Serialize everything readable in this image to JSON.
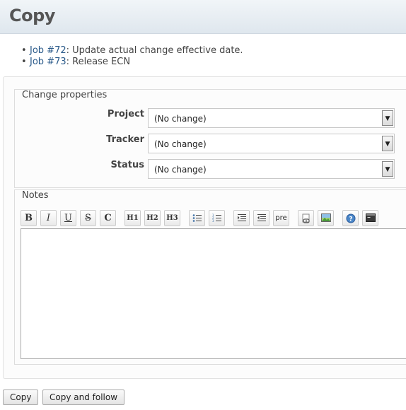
{
  "page": {
    "title": "Copy"
  },
  "jobs": [
    {
      "link": "Job #72",
      "text": ": Update actual change effective date."
    },
    {
      "link": "Job #73",
      "text": ": Release ECN"
    }
  ],
  "properties": {
    "legend": "Change properties",
    "fields": [
      {
        "label": "Project",
        "value": "(No change)"
      },
      {
        "label": "Tracker",
        "value": "(No change)"
      },
      {
        "label": "Status",
        "value": "(No change)"
      }
    ]
  },
  "notes": {
    "legend": "Notes",
    "value": "",
    "toolbar": {
      "bold": "B",
      "italic": "I",
      "underline": "U",
      "strike": "S",
      "code": "C",
      "h1": "H1",
      "h2": "H2",
      "h3": "H3",
      "pre": "pre",
      "icons": [
        "unordered-list-icon",
        "ordered-list-icon",
        "indent-icon",
        "outdent-icon",
        "link-icon",
        "image-icon",
        "help-icon",
        "preview-icon"
      ]
    }
  },
  "buttons": {
    "copy": "Copy",
    "copy_follow": "Copy and follow"
  },
  "colors": {
    "link": "#2a5a8a",
    "header_bg": "#dfe7ee"
  }
}
